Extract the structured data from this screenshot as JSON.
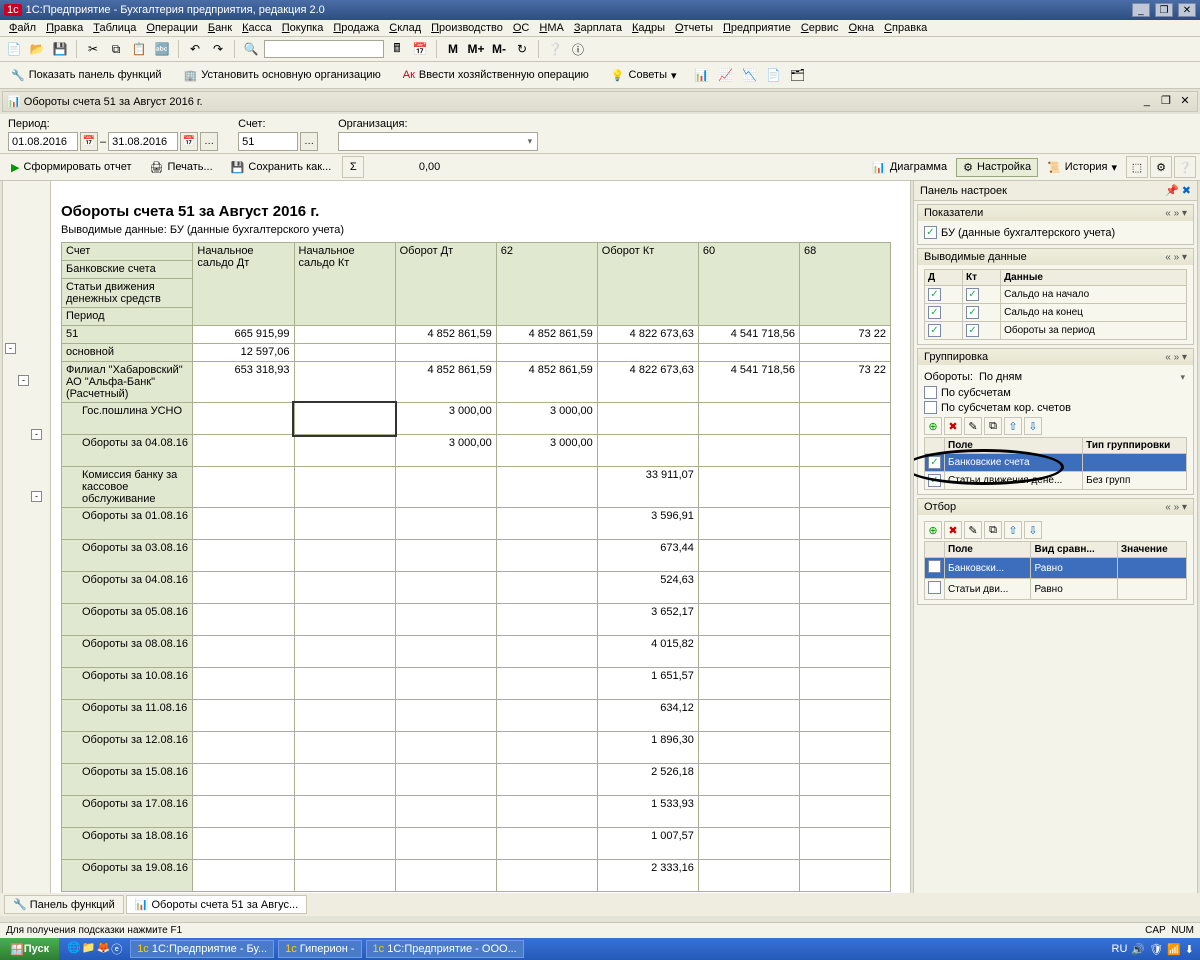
{
  "title": "1С:Предприятие - Бухгалтерия предприятия, редакция 2.0",
  "menu": [
    "Файл",
    "Правка",
    "Таблица",
    "Операции",
    "Банк",
    "Касса",
    "Покупка",
    "Продажа",
    "Склад",
    "Производство",
    "ОС",
    "НМА",
    "Зарплата",
    "Кадры",
    "Отчеты",
    "Предприятие",
    "Сервис",
    "Окна",
    "Справка"
  ],
  "tb2": {
    "panel": "Показать панель функций",
    "setorg": "Установить основную организацию",
    "hozop": "Ввести хозяйственную операцию",
    "advice": "Советы"
  },
  "subwin": "Обороты счета 51 за Август 2016 г.",
  "params": {
    "period": "Период:",
    "from": "01.08.2016",
    "to": "31.08.2016",
    "schet": "Счет:",
    "schet_v": "51",
    "org": "Организация:"
  },
  "rpttb": {
    "form": "Сформировать отчет",
    "print": "Печать...",
    "save": "Сохранить как...",
    "sum": "0,00",
    "chart": "Диаграмма",
    "settings": "Настройка",
    "history": "История"
  },
  "report": {
    "title": "Обороты счета 51 за Август 2016 г.",
    "sub": "Выводимые данные:   БУ (данные бухгалтерского учета)",
    "hdr_rows": [
      [
        "Счет",
        "Начальное сальдо Дт",
        "Начальное сальдо Кт",
        "Оборот Дт",
        "62",
        "Оборот Кт",
        "60",
        "68"
      ],
      [
        "Банковские счета",
        "",
        "",
        "",
        "",
        "",
        "",
        ""
      ],
      [
        "Статьи движения денежных средств",
        "",
        "",
        "",
        "",
        "",
        "",
        ""
      ],
      [
        "Период",
        "",
        "",
        "",
        "",
        "",
        "",
        ""
      ]
    ],
    "rows": [
      {
        "a": "51",
        "b": "665 915,99",
        "d": "4 852 861,59",
        "e": "4 852 861,59",
        "f": "4 822 673,63",
        "g": "4 541 718,56",
        "h": "73 22"
      },
      {
        "a": "основной",
        "b": "12 597,06"
      },
      {
        "a": "Филиал \"Хабаровский\" АО \"Альфа-Банк\" (Расчетный)",
        "b": "653 318,93",
        "d": "4 852 861,59",
        "e": "4 852 861,59",
        "f": "4 822 673,63",
        "g": "4 541 718,56",
        "h": "73 22",
        "tall": true
      },
      {
        "a": "Гос.пошлина УСНО",
        "d": "3 000,00",
        "e": "3 000,00",
        "selC": true,
        "tall": true,
        "indent": 1
      },
      {
        "a": "Обороты за 04.08.16",
        "d": "3 000,00",
        "e": "3 000,00",
        "indent": 1,
        "tall": true
      },
      {
        "a": "Комиссия банку за кассовое обслуживание",
        "f": "33 911,07",
        "indent": 1,
        "tall": true
      },
      {
        "a": "Обороты за 01.08.16",
        "f": "3 596,91",
        "indent": 1,
        "tall": true
      },
      {
        "a": "Обороты за 03.08.16",
        "f": "673,44",
        "indent": 1,
        "tall": true
      },
      {
        "a": "Обороты за 04.08.16",
        "f": "524,63",
        "indent": 1,
        "tall": true
      },
      {
        "a": "Обороты за 05.08.16",
        "f": "3 652,17",
        "indent": 1,
        "tall": true
      },
      {
        "a": "Обороты за 08.08.16",
        "f": "4 015,82",
        "indent": 1,
        "tall": true
      },
      {
        "a": "Обороты за 10.08.16",
        "f": "1 651,57",
        "indent": 1,
        "tall": true
      },
      {
        "a": "Обороты за 11.08.16",
        "f": "634,12",
        "indent": 1,
        "tall": true
      },
      {
        "a": "Обороты за 12.08.16",
        "f": "1 896,30",
        "indent": 1,
        "tall": true
      },
      {
        "a": "Обороты за 15.08.16",
        "f": "2 526,18",
        "indent": 1,
        "tall": true
      },
      {
        "a": "Обороты за 17.08.16",
        "f": "1 533,93",
        "indent": 1,
        "tall": true
      },
      {
        "a": "Обороты за 18.08.16",
        "f": "1 007,57",
        "indent": 1,
        "tall": true
      },
      {
        "a": "Обороты за 19.08.16",
        "f": "2 333,16",
        "indent": 1,
        "tall": true
      }
    ]
  },
  "settings": {
    "panel_title": "Панель настроек",
    "s1": {
      "t": "Показатели",
      "items": [
        "БУ (данные бухгалтерского учета)"
      ]
    },
    "s2": {
      "t": "Выводимые данные",
      "hdr": [
        "Д",
        "Кт",
        "Данные"
      ],
      "rows": [
        "Сальдо на начало",
        "Сальдо на конец",
        "Обороты за период"
      ]
    },
    "s3": {
      "t": "Группировка",
      "turn_lbl": "Обороты:",
      "turn_v": "По дням",
      "sub1": "По субсчетам",
      "sub2": "По субсчетам кор. счетов",
      "cols": [
        "Поле",
        "Тип группировки"
      ],
      "rows": [
        [
          "Банковские счета",
          ""
        ],
        [
          "Статьи движения дене...",
          "Без групп"
        ]
      ]
    },
    "s4": {
      "t": "Отбор",
      "cols": [
        "Поле",
        "Вид сравн...",
        "Значение"
      ],
      "rows": [
        [
          "Банковски...",
          "Равно",
          ""
        ],
        [
          "Статьи дви...",
          "Равно",
          ""
        ]
      ]
    }
  },
  "tabs": [
    "Панель функций",
    "Обороты счета 51 за Авгус..."
  ],
  "hint": "Для получения подсказки нажмите F1",
  "status": {
    "cap": "CAP",
    "num": "NUM"
  },
  "taskbar": {
    "start": "Пуск",
    "tasks": [
      "1С:Предприятие - Бу...",
      "Гиперион -",
      "1С:Предприятие - ООО..."
    ],
    "lang": "RU"
  }
}
